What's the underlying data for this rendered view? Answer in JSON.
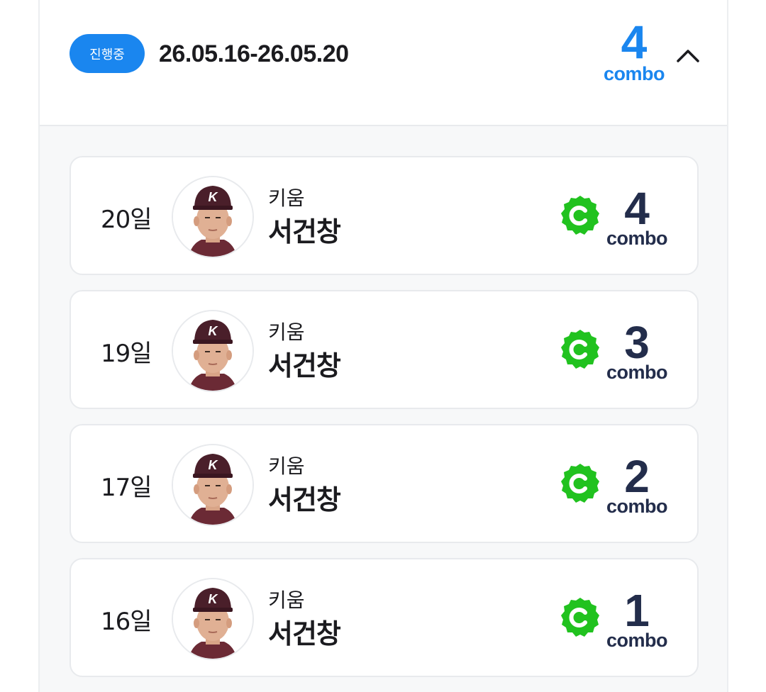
{
  "header": {
    "status_label": "진행중",
    "date_range": "26.05.16-26.05.20",
    "combo_count": "4",
    "combo_label": "combo"
  },
  "records": [
    {
      "day": "20일",
      "team": "키움",
      "player": "서건창",
      "combo_count": "4",
      "combo_label": "combo"
    },
    {
      "day": "19일",
      "team": "키움",
      "player": "서건창",
      "combo_count": "3",
      "combo_label": "combo"
    },
    {
      "day": "17일",
      "team": "키움",
      "player": "서건창",
      "combo_count": "2",
      "combo_label": "combo"
    },
    {
      "day": "16일",
      "team": "키움",
      "player": "서건창",
      "combo_count": "1",
      "combo_label": "combo"
    }
  ],
  "icons": {
    "collapse": "chevron-up-icon",
    "coin": "combo-coin-icon",
    "avatar": "player-avatar"
  },
  "colors": {
    "accent_blue": "#1a86ef",
    "coin_green": "#21c21f",
    "combo_navy": "#232d4b",
    "background_gray": "#f7f8f9"
  }
}
